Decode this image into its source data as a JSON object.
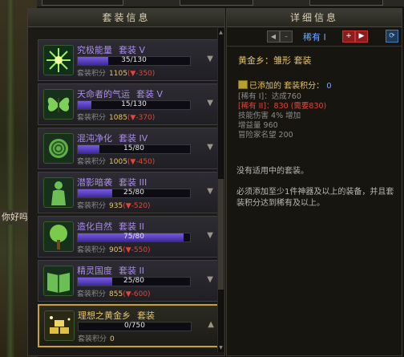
{
  "left_panel": {
    "title": "套装信息",
    "items": [
      {
        "name": "究极能量",
        "tier": "套装 V",
        "progress": "35/130",
        "progress_ratio": 0.27,
        "score_label": "套装积分",
        "score": "1105",
        "delta": "(▼-350)",
        "icon": "starburst-icon"
      },
      {
        "name": "天命者的气运",
        "tier": "套装 V",
        "progress": "15/130",
        "progress_ratio": 0.12,
        "score_label": "套装积分",
        "score": "1085",
        "delta": "(▼-370)",
        "icon": "butterfly-icon"
      },
      {
        "name": "混沌净化",
        "tier": "套装 IV",
        "progress": "15/80",
        "progress_ratio": 0.19,
        "score_label": "套装积分",
        "score": "1005",
        "delta": "(▼-450)",
        "icon": "rose-icon"
      },
      {
        "name": "潜影暗袭",
        "tier": "套装 III",
        "progress": "25/80",
        "progress_ratio": 0.31,
        "score_label": "套装积分",
        "score": "935",
        "delta": "(▼-520)",
        "icon": "figure-icon"
      },
      {
        "name": "造化自然",
        "tier": "套装 II",
        "progress": "75/80",
        "progress_ratio": 0.94,
        "score_label": "套装积分",
        "score": "905",
        "delta": "(▼-550)",
        "icon": "tree-icon"
      },
      {
        "name": "精灵国度",
        "tier": "套装 II",
        "progress": "25/80",
        "progress_ratio": 0.31,
        "score_label": "套装积分",
        "score": "855",
        "delta": "(▼-600)",
        "icon": "book-icon"
      },
      {
        "name": "理想之黄金乡",
        "tier": "套装",
        "progress": "0/750",
        "progress_ratio": 0.0,
        "score_label": "套装积分",
        "score": "0",
        "delta": "",
        "icon": "gold-bars-icon"
      }
    ]
  },
  "detail": {
    "title": "详细信息",
    "rarity": "稀有 I",
    "set_title": "黄金乡：雏形 套装",
    "added_label": "已添加的 套装积分：",
    "added_value": "0",
    "lines": [
      {
        "text": "[稀有 I]：达成760",
        "red": false
      },
      {
        "text": "[稀有 II]：830 (需要830)",
        "red": true
      },
      {
        "text": "技能伤害 4% 增加",
        "red": false
      },
      {
        "text": "增益量 960",
        "red": false
      },
      {
        "text": "冒险家名望 200",
        "red": false
      }
    ],
    "note1": "没有适用中的套装。",
    "note2": "必须添加至少1件神器及以上的装备，并且套装积分达到稀有及以上。"
  },
  "left_tag": "你好吗",
  "colors": {
    "accent_gold": "#c8a32c",
    "purple_name": "#a98ce8",
    "negative": "#e0473a",
    "rarity_blue": "#6fa8ff"
  }
}
